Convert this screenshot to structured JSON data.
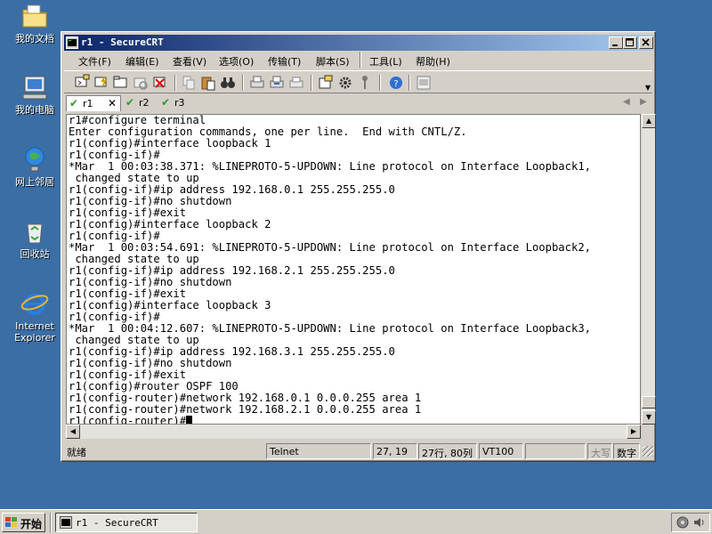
{
  "desktop": {
    "icons": [
      {
        "label": "我的文档",
        "icon": "folder-icon"
      },
      {
        "label": "我的电脑",
        "icon": "computer-icon"
      },
      {
        "label": "网上邻居",
        "icon": "network-icon"
      },
      {
        "label": "回收站",
        "icon": "recycle-bin-icon"
      },
      {
        "label": "Internet Explorer",
        "icon": "internet-explorer-icon"
      }
    ]
  },
  "window": {
    "title": "r1 - SecureCRT",
    "menu": [
      "文件(F)",
      "编辑(E)",
      "查看(V)",
      "选项(O)",
      "传输(T)",
      "脚本(S)",
      "工具(L)",
      "帮助(H)"
    ],
    "tabs": [
      {
        "label": "r1",
        "active": true
      },
      {
        "label": "r2",
        "active": false
      },
      {
        "label": "r3",
        "active": false
      }
    ],
    "tab_close": "✕"
  },
  "terminal": {
    "lines": [
      "r1#configure terminal",
      "Enter configuration commands, one per line.  End with CNTL/Z.",
      "r1(config)#interface loopback 1",
      "r1(config-if)#",
      "*Mar  1 00:03:38.371: %LINEPROTO-5-UPDOWN: Line protocol on Interface Loopback1,",
      " changed state to up",
      "r1(config-if)#ip address 192.168.0.1 255.255.255.0",
      "r1(config-if)#no shutdown",
      "r1(config-if)#exit",
      "r1(config)#interface loopback 2",
      "r1(config-if)#",
      "*Mar  1 00:03:54.691: %LINEPROTO-5-UPDOWN: Line protocol on Interface Loopback2,",
      " changed state to up",
      "r1(config-if)#ip address 192.168.2.1 255.255.255.0",
      "r1(config-if)#no shutdown",
      "r1(config-if)#exit",
      "r1(config)#interface loopback 3",
      "r1(config-if)#",
      "*Mar  1 00:04:12.607: %LINEPROTO-5-UPDOWN: Line protocol on Interface Loopback3,",
      " changed state to up",
      "r1(config-if)#ip address 192.168.3.1 255.255.255.0",
      "r1(config-if)#no shutdown",
      "r1(config-if)#exit",
      "r1(config)#router OSPF 100",
      "r1(config-router)#network 192.168.0.1 0.0.0.255 area 1",
      "r1(config-router)#network 192.168.2.1 0.0.0.255 area 1",
      "r1(config-router)#"
    ]
  },
  "statusbar": {
    "ready": "就绪",
    "protocol": "Telnet",
    "cursor_pos": "27, 19",
    "rows_cols": "27行, 80列",
    "emulation": "VT100",
    "caps": "大写",
    "numlock": "数字"
  },
  "taskbar": {
    "start_label": "开始",
    "task_label": "r1 - SecureCRT"
  },
  "colors": {
    "desktop": "#3a6ea5",
    "titlebar_start": "#0a246a",
    "titlebar_end": "#a6caf0",
    "tab_check": "#2e9a2e"
  }
}
